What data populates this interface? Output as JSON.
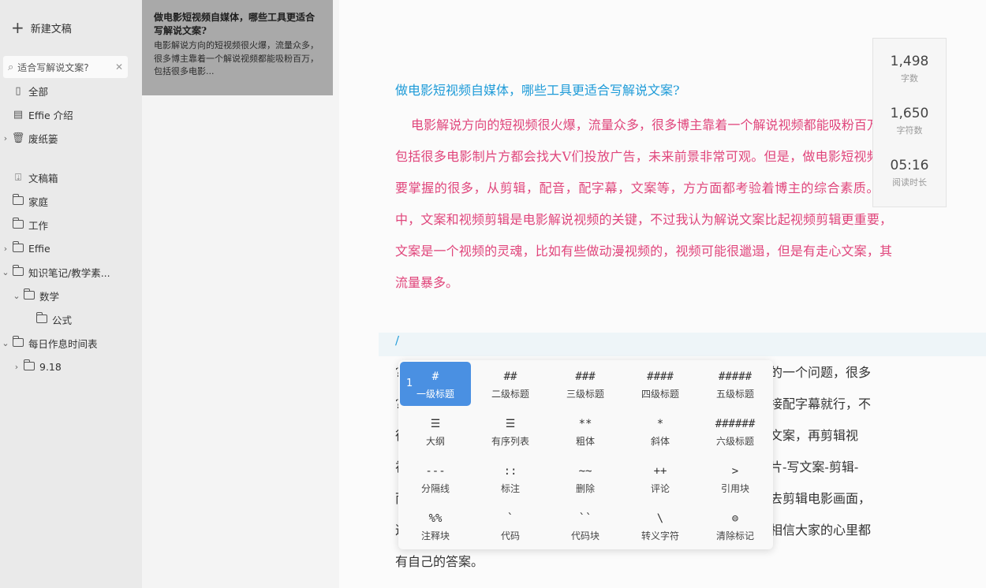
{
  "sidebar": {
    "new_doc_label": "新建文稿",
    "search_text": "适合写解说文案?",
    "items": [
      {
        "label": "全部",
        "arrow": "",
        "icon": "notebook-icon"
      },
      {
        "label": "Effie 介绍",
        "arrow": "",
        "icon": "document-icon"
      },
      {
        "label": "废纸篓",
        "arrow": "›",
        "icon": "trash-icon"
      },
      {
        "label": "文稿箱",
        "arrow": "",
        "icon": "inbox-icon"
      },
      {
        "label": "家庭",
        "arrow": "",
        "icon": "folder-icon"
      },
      {
        "label": "工作",
        "arrow": "",
        "icon": "folder-icon"
      },
      {
        "label": "Effie",
        "arrow": "›",
        "icon": "folder-icon"
      },
      {
        "label": "知识笔记/教学素...",
        "arrow": "⌄",
        "icon": "folder-icon"
      },
      {
        "label": "数学",
        "arrow": "⌄",
        "icon": "folder-icon"
      },
      {
        "label": "公式",
        "arrow": "",
        "icon": "folder-icon"
      },
      {
        "label": "每日作息时间表",
        "arrow": "⌄",
        "icon": "folder-icon"
      },
      {
        "label": "9.18",
        "arrow": "›",
        "icon": "folder-icon"
      }
    ]
  },
  "doclist": {
    "card": {
      "title": "做电影短视频自媒体，哪些工具更适合写解说文案?",
      "preview": "电影解说方向的短视频很火爆，流量众多，很多博主靠着一个解说视频都能吸粉百万，包括很多电影..."
    }
  },
  "editor": {
    "heading": "做电影短视频自媒体，哪些工具更适合写解说文案?",
    "pink_paragraph": "电影解说方向的短视频很火爆，流量众多，很多博主靠着一个解说视频都能吸粉百万，包括很多电影制片方都会找大V们投放广告，未来前景非常可观。但是，做电影短视频需要掌握的很多，从剪辑，配音，配字幕，文案等，方方面都考验着博主的综合素质。其中，文案和视频剪辑是电影解说视频的关键，不过我认为解说文案比起视频剪辑更重要，文案是一个视频的灵魂，比如有些做动漫视频的，视频可能很邋遢，但是有走心文案，其流量暴多。",
    "cursor_text": "/",
    "dark_lines": [
      "的一个问题，很多",
      "接配字幕就行，不",
      "文案，再剪辑视",
      "片-写文案-剪辑-",
      "去剪辑电影画面，",
      "相信大家的心里都",
      "有自己的答案。"
    ],
    "left_edge_glyphs": [
      "?",
      "?",
      "很",
      "视",
      "而",
      "这"
    ]
  },
  "stats": [
    {
      "num": "1,498",
      "label": "字数"
    },
    {
      "num": "1,650",
      "label": "字符数"
    },
    {
      "num": "05:16",
      "label": "阅读时长"
    }
  ],
  "md_menu": {
    "active_shortcut": "1",
    "cells": [
      {
        "sym": "#",
        "label": "一级标题"
      },
      {
        "sym": "##",
        "label": "二级标题"
      },
      {
        "sym": "###",
        "label": "三级标题"
      },
      {
        "sym": "####",
        "label": "四级标题"
      },
      {
        "sym": "#####",
        "label": "五级标题"
      },
      {
        "sym": "☰",
        "label": "大纲"
      },
      {
        "sym": "☰",
        "label": "有序列表"
      },
      {
        "sym": "**",
        "label": "粗体"
      },
      {
        "sym": "*",
        "label": "斜体"
      },
      {
        "sym": "######",
        "label": "六级标题"
      },
      {
        "sym": "---",
        "label": "分隔线"
      },
      {
        "sym": "::",
        "label": "标注"
      },
      {
        "sym": "~~",
        "label": "删除"
      },
      {
        "sym": "++",
        "label": "评论"
      },
      {
        "sym": ">",
        "label": "引用块"
      },
      {
        "sym": "%%",
        "label": "注释块"
      },
      {
        "sym": "`",
        "label": "代码"
      },
      {
        "sym": "``",
        "label": "代码块"
      },
      {
        "sym": "\\",
        "label": "转义字符"
      },
      {
        "sym": "⊜",
        "label": "清除标记"
      }
    ]
  }
}
